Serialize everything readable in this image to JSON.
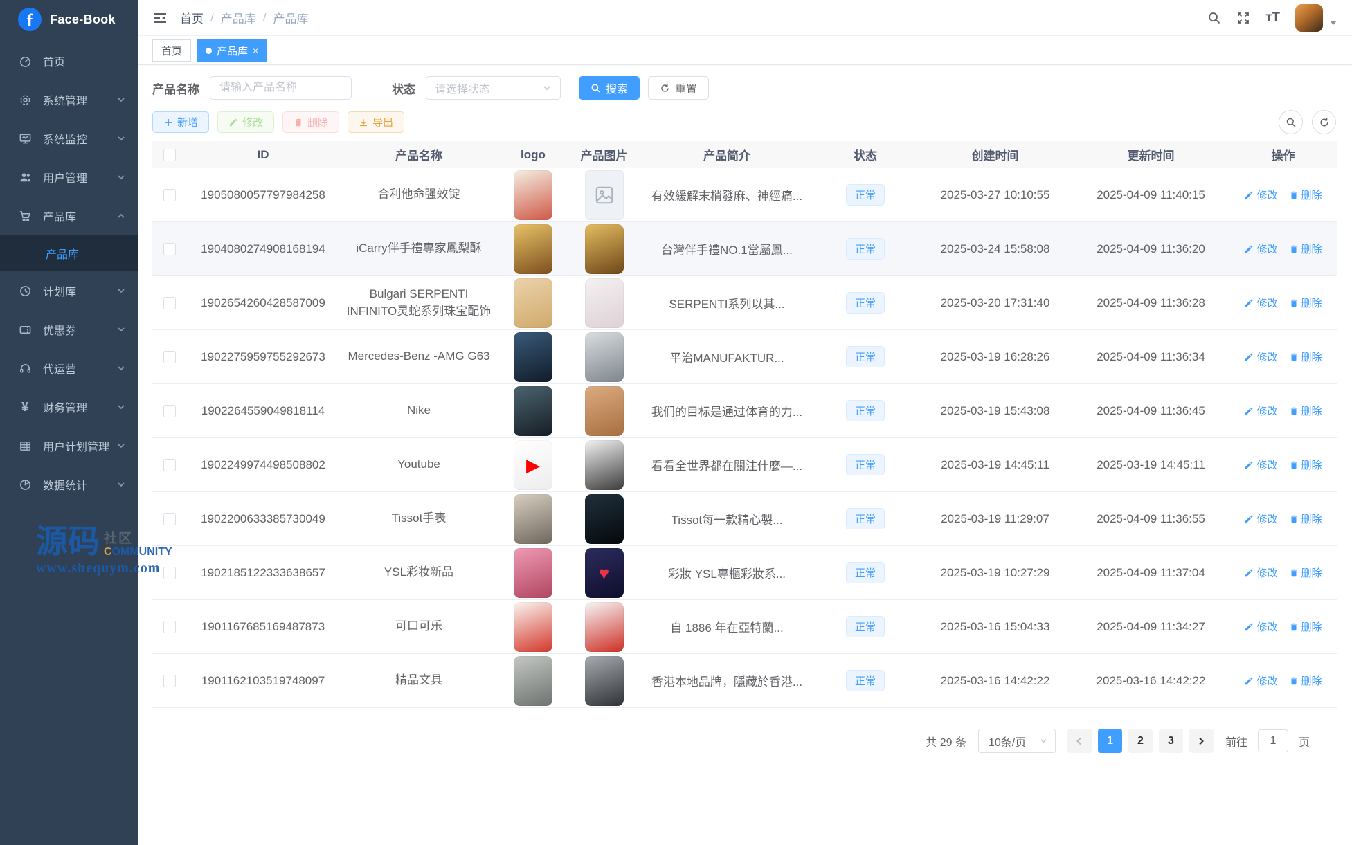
{
  "app": {
    "title": "Face-Book"
  },
  "colors": {
    "primary": "#409eff",
    "sidebar_bg": "#304156",
    "status_blue": "#409eff"
  },
  "sidebar": {
    "items": [
      {
        "label": "首页"
      },
      {
        "label": "系统管理"
      },
      {
        "label": "系统监控"
      },
      {
        "label": "用户管理"
      },
      {
        "label": "产品库",
        "children": [
          {
            "label": "产品库",
            "active": true
          }
        ]
      },
      {
        "label": "计划库"
      },
      {
        "label": "优惠券"
      },
      {
        "label": "代运营"
      },
      {
        "label": "财务管理"
      },
      {
        "label": "用户计划管理"
      },
      {
        "label": "数据统计"
      }
    ]
  },
  "watermark": {
    "main": "源码",
    "cn": "社区",
    "en_first": "C",
    "en_rest": "OMMUNITY",
    "url": "www.shequym.com"
  },
  "header": {
    "breadcrumbs": [
      "首页",
      "产品库",
      "产品库"
    ]
  },
  "tags": {
    "home": "首页",
    "active": "产品库",
    "close": "×"
  },
  "filters": {
    "name_label": "产品名称",
    "name_placeholder": "请输入产品名称",
    "status_label": "状态",
    "status_placeholder": "请选择状态",
    "search_label": "搜索",
    "reset_label": "重置"
  },
  "toolbar": {
    "add": "新增",
    "edit": "修改",
    "delete": "删除",
    "export": "导出"
  },
  "table": {
    "columns": [
      "ID",
      "产品名称",
      "logo",
      "产品图片",
      "产品简介",
      "状态",
      "创建时间",
      "更新时间",
      "操作"
    ],
    "edit_label": "修改",
    "delete_label": "删除",
    "rows": [
      {
        "id": "1905080057797984258",
        "name": "合利他命强效锭",
        "intro": "有效緩解末梢發麻、神經痛...",
        "status": "正常",
        "created": "2025-03-27 10:10:55",
        "updated": "2025-04-09 11:40:15",
        "logo": {
          "colors": [
            "#f4efe2",
            "#cf5848"
          ]
        },
        "image": {
          "placeholder": true
        }
      },
      {
        "id": "1904080274908168194",
        "name": "iCarry伴手禮專家鳳梨酥",
        "intro": "台灣伴手禮NO.1當屬鳳...",
        "status": "正常",
        "created": "2025-03-24 15:58:08",
        "updated": "2025-04-09 11:36:20",
        "highlight": true,
        "logo": {
          "colors": [
            "#e8c268",
            "#7c4f1d"
          ]
        },
        "image": {
          "colors": [
            "#e3bd62",
            "#6f4618"
          ]
        }
      },
      {
        "id": "1902654260428587009",
        "name": "Bulgari SERPENTI INFINITO灵蛇系列珠宝配饰",
        "intro": "SERPENTI系列以其...",
        "status": "正常",
        "created": "2025-03-20 17:31:40",
        "updated": "2025-04-09 11:36:28",
        "logo": {
          "colors": [
            "#ecd3ac",
            "#cfa96a"
          ]
        },
        "image": {
          "colors": [
            "#f4f0f2",
            "#ded2d6"
          ]
        }
      },
      {
        "id": "1902275959755292673",
        "name": "Mercedes-Benz -AMG G63",
        "intro": "平治MANUFAKTUR...",
        "status": "正常",
        "created": "2025-03-19 16:28:26",
        "updated": "2025-04-09 11:36:34",
        "logo": {
          "colors": [
            "#3a5a78",
            "#101c2a"
          ]
        },
        "image": {
          "colors": [
            "#d9dde0",
            "#7e868d"
          ]
        }
      },
      {
        "id": "1902264559049818114",
        "name": "Nike",
        "intro": "我们的目标是通过体育的力...",
        "status": "正常",
        "created": "2025-03-19 15:43:08",
        "updated": "2025-04-09 11:36:45",
        "logo": {
          "colors": [
            "#4b6470",
            "#161d24"
          ]
        },
        "image": {
          "colors": [
            "#dcab81",
            "#a86f3f"
          ]
        }
      },
      {
        "id": "1902249974498508802",
        "name": "Youtube",
        "intro": "看看全世界都在關注什麼—...",
        "status": "正常",
        "created": "2025-03-19 14:45:11",
        "updated": "2025-03-19 14:45:11",
        "logo": {
          "colors": [
            "#ffffff",
            "#ededed"
          ],
          "glyph": "▶",
          "glyph_color": "#ff0000"
        },
        "image": {
          "colors": [
            "#f2f2f2",
            "#3c3c3c"
          ]
        }
      },
      {
        "id": "1902200633385730049",
        "name": "Tissot手表",
        "intro": "Tissot每一款精心製...",
        "status": "正常",
        "created": "2025-03-19 11:29:07",
        "updated": "2025-04-09 11:36:55",
        "logo": {
          "colors": [
            "#d8cfc2",
            "#6f675c"
          ]
        },
        "image": {
          "colors": [
            "#20303c",
            "#05080c"
          ]
        }
      },
      {
        "id": "1902185122333638657",
        "name": "YSL彩妆新品",
        "intro": "彩妝 YSL專櫃彩妝系...",
        "status": "正常",
        "created": "2025-03-19 10:27:29",
        "updated": "2025-04-09 11:37:04",
        "logo": {
          "colors": [
            "#ef9ab5",
            "#b0465f"
          ]
        },
        "image": {
          "colors": [
            "#2c2c5e",
            "#0e0e2c"
          ],
          "glyph": "♥",
          "glyph_color": "#e8334a"
        }
      },
      {
        "id": "1901167685169487873",
        "name": "可口可乐",
        "intro": "自 1886 年在亞特蘭...",
        "status": "正常",
        "created": "2025-03-16 15:04:33",
        "updated": "2025-04-09 11:34:27",
        "logo": {
          "colors": [
            "#faf6f0",
            "#d2372c"
          ]
        },
        "image": {
          "colors": [
            "#f7f7f7",
            "#cd2f26"
          ]
        }
      },
      {
        "id": "1901162103519748097",
        "name": "精品文具",
        "intro": "香港本地品牌，隱藏於香港...",
        "status": "正常",
        "created": "2025-03-16 14:42:22",
        "updated": "2025-03-16 14:42:22",
        "logo": {
          "colors": [
            "#c4c7c2",
            "#6e7370"
          ]
        },
        "image": {
          "colors": [
            "#a7abb0",
            "#2f3337"
          ]
        }
      }
    ]
  },
  "pagination": {
    "total_label": "共 29 条",
    "page_size_label": "10条/页",
    "pages": [
      "1",
      "2",
      "3"
    ],
    "active_page": "1",
    "goto_label": "前往",
    "goto_value": "1",
    "unit_label": "页"
  }
}
